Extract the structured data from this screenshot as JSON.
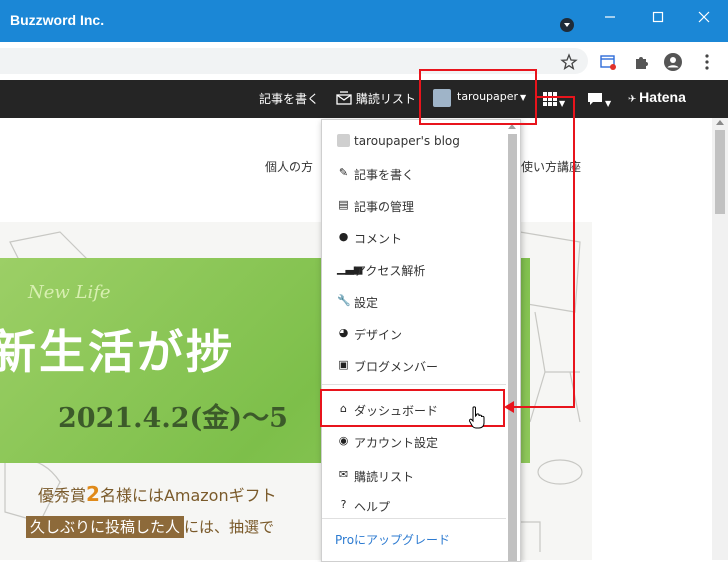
{
  "window": {
    "title": "Buzzword Inc."
  },
  "navbar": {
    "write_article": "記事を書く",
    "reading_list": "購読リスト",
    "username": "taroupaper",
    "brand": "Hatena"
  },
  "page": {
    "subnav_left": "個人の方",
    "subnav_right": "使い方講座",
    "banner_script": "New Life",
    "banner_headline": "新生活が捗",
    "date": "2021.4.2(金)〜5",
    "promo_line1_a": "優秀賞",
    "promo_line1_b": "2",
    "promo_line1_c": "名様にはAmazonギフト",
    "promo_line2_highlight": "久しぶりに投稿した人",
    "promo_line2_rest": "には、抽選で"
  },
  "dropdown": {
    "items": [
      {
        "label": "taroupaper's blog",
        "icon": "blog-avatar-icon"
      },
      {
        "label": "記事を書く",
        "icon": "edit-icon"
      },
      {
        "label": "記事の管理",
        "icon": "document-icon"
      },
      {
        "label": "コメント",
        "icon": "comment-icon"
      },
      {
        "label": "アクセス解析",
        "icon": "analytics-icon"
      },
      {
        "label": "設定",
        "icon": "wrench-icon"
      },
      {
        "label": "デザイン",
        "icon": "palette-icon"
      },
      {
        "label": "ブログメンバー",
        "icon": "members-icon"
      },
      {
        "label": "ダッシュボード",
        "icon": "home-icon"
      },
      {
        "label": "アカウント設定",
        "icon": "account-icon"
      },
      {
        "label": "購読リスト",
        "icon": "reading-list-icon"
      },
      {
        "label": "ヘルプ",
        "icon": "help-icon"
      },
      {
        "label": "Proにアップグレード",
        "icon": ""
      }
    ]
  },
  "colors": {
    "titlebar": "#1b87d6",
    "navbar": "#252525",
    "annotation": "#e8141c",
    "link": "#2d7bd1"
  }
}
